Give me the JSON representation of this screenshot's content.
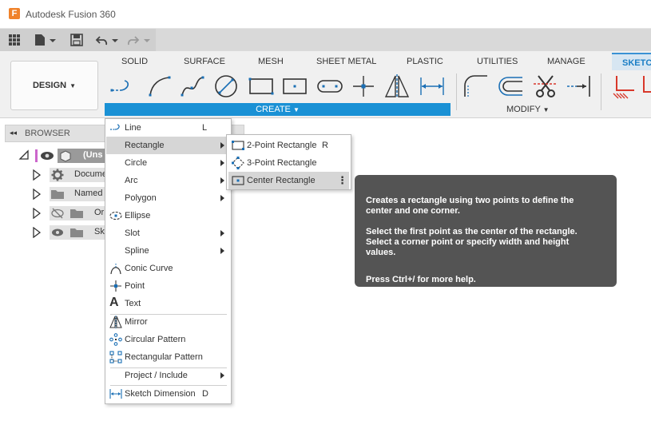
{
  "app": {
    "logo_letter": "F",
    "title": "Autodesk Fusion 360"
  },
  "ribbon": {
    "workspace_label": "DESIGN",
    "tabs": [
      "SOLID",
      "SURFACE",
      "MESH",
      "SHEET METAL",
      "PLASTIC",
      "UTILITIES",
      "MANAGE",
      "SKETCH"
    ],
    "create_label": "CREATE",
    "modify_label": "MODIFY",
    "active_tab_color": "#1a7ec5",
    "create_bar_color": "#1a91d5"
  },
  "browser": {
    "title": "BROWSER",
    "rows": [
      {
        "label": "(Uns",
        "icon": "component-icon"
      },
      {
        "label": "Docume",
        "icon": "gear-icon"
      },
      {
        "label": "Named V",
        "icon": "folder-icon"
      },
      {
        "label": "Or",
        "icon": "folder-icon"
      },
      {
        "label": "Sk",
        "icon": "folder-icon"
      }
    ]
  },
  "create_menu": {
    "items": [
      {
        "label": "Line",
        "shortcut": "L"
      },
      {
        "label": "Rectangle"
      },
      {
        "label": "Circle"
      },
      {
        "label": "Arc"
      },
      {
        "label": "Polygon"
      },
      {
        "label": "Ellipse"
      },
      {
        "label": "Slot"
      },
      {
        "label": "Spline"
      },
      {
        "label": "Conic Curve"
      },
      {
        "label": "Point"
      },
      {
        "label": "Text"
      },
      {
        "label": "Mirror"
      },
      {
        "label": "Circular Pattern"
      },
      {
        "label": "Rectangular Pattern"
      },
      {
        "label": "Project / Include"
      },
      {
        "label": "Sketch Dimension",
        "shortcut": "D"
      }
    ]
  },
  "rectangle_submenu": {
    "items": [
      {
        "label": "2-Point Rectangle",
        "shortcut": "R"
      },
      {
        "label": "3-Point Rectangle"
      },
      {
        "label": "Center Rectangle"
      }
    ]
  },
  "tooltip": {
    "line1": "Creates a rectangle using two points to define the",
    "line2": "center and one corner.",
    "line3": "Select the first point as the center of the rectangle.",
    "line4": "Select a corner point or specify width and height",
    "line5": "values.",
    "line6": "Press Ctrl+/ for more help."
  }
}
